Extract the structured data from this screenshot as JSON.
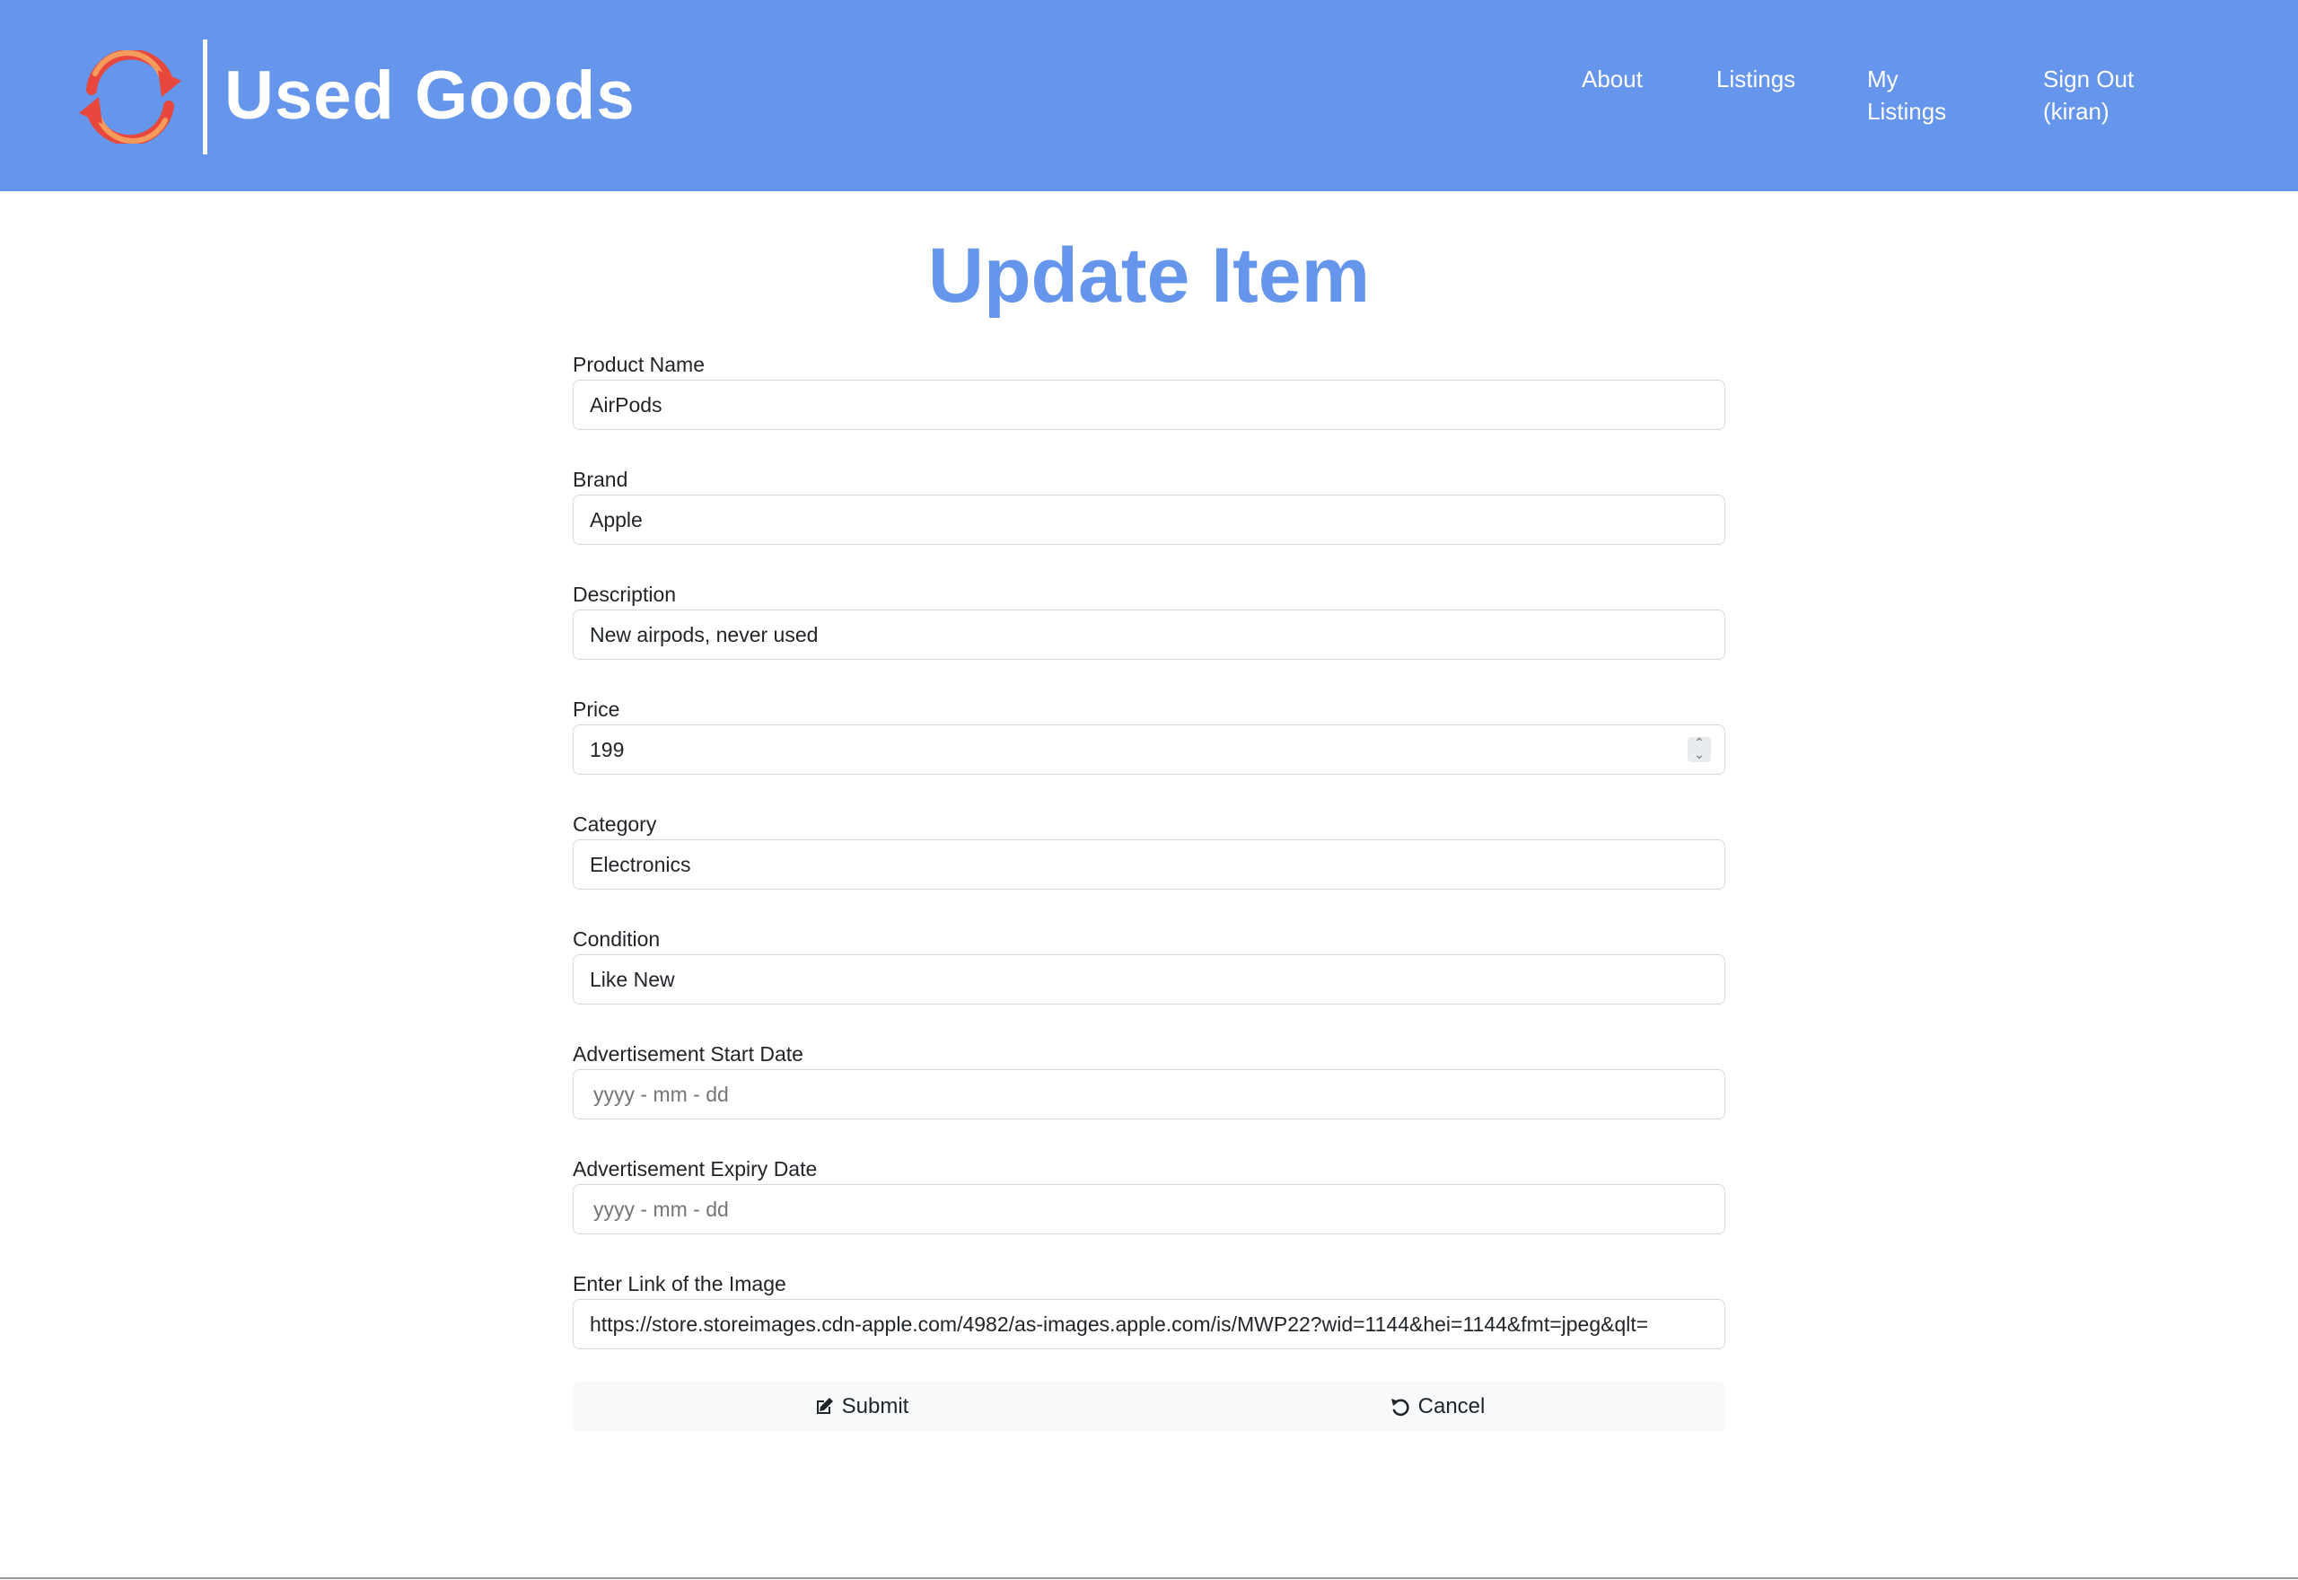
{
  "header": {
    "brand": "Used Goods",
    "nav": {
      "about": "About",
      "listings": "Listings",
      "my_listings_line1": "My",
      "my_listings_line2": "Listings",
      "sign_out_line1": "Sign Out",
      "sign_out_line2": "(kiran)"
    },
    "colors": {
      "primary": "#6695ec",
      "logo_red": "#e8473d",
      "logo_orange": "#f59c5c"
    }
  },
  "main": {
    "title": "Update Item",
    "fields": {
      "product_name": {
        "label": "Product Name",
        "value": "AirPods"
      },
      "brand": {
        "label": "Brand",
        "value": "Apple"
      },
      "description": {
        "label": "Description",
        "value": "New airpods, never used"
      },
      "price": {
        "label": "Price",
        "value": "199"
      },
      "category": {
        "label": "Category",
        "value": "Electronics"
      },
      "condition": {
        "label": "Condition",
        "value": "Like New"
      },
      "start_date": {
        "label": "Advertisement Start Date",
        "placeholder": "yyyy - mm - dd"
      },
      "expiry_date": {
        "label": "Advertisement Expiry Date",
        "placeholder": "yyyy - mm - dd"
      },
      "image_link": {
        "label": "Enter Link of the Image",
        "value": "https://store.storeimages.cdn-apple.com/4982/as-images.apple.com/is/MWP22?wid=1144&hei=1144&fmt=jpeg&qlt="
      }
    },
    "buttons": {
      "submit": "Submit",
      "cancel": "Cancel"
    },
    "icons": {
      "submit": "edit-icon",
      "cancel": "undo-icon"
    }
  }
}
